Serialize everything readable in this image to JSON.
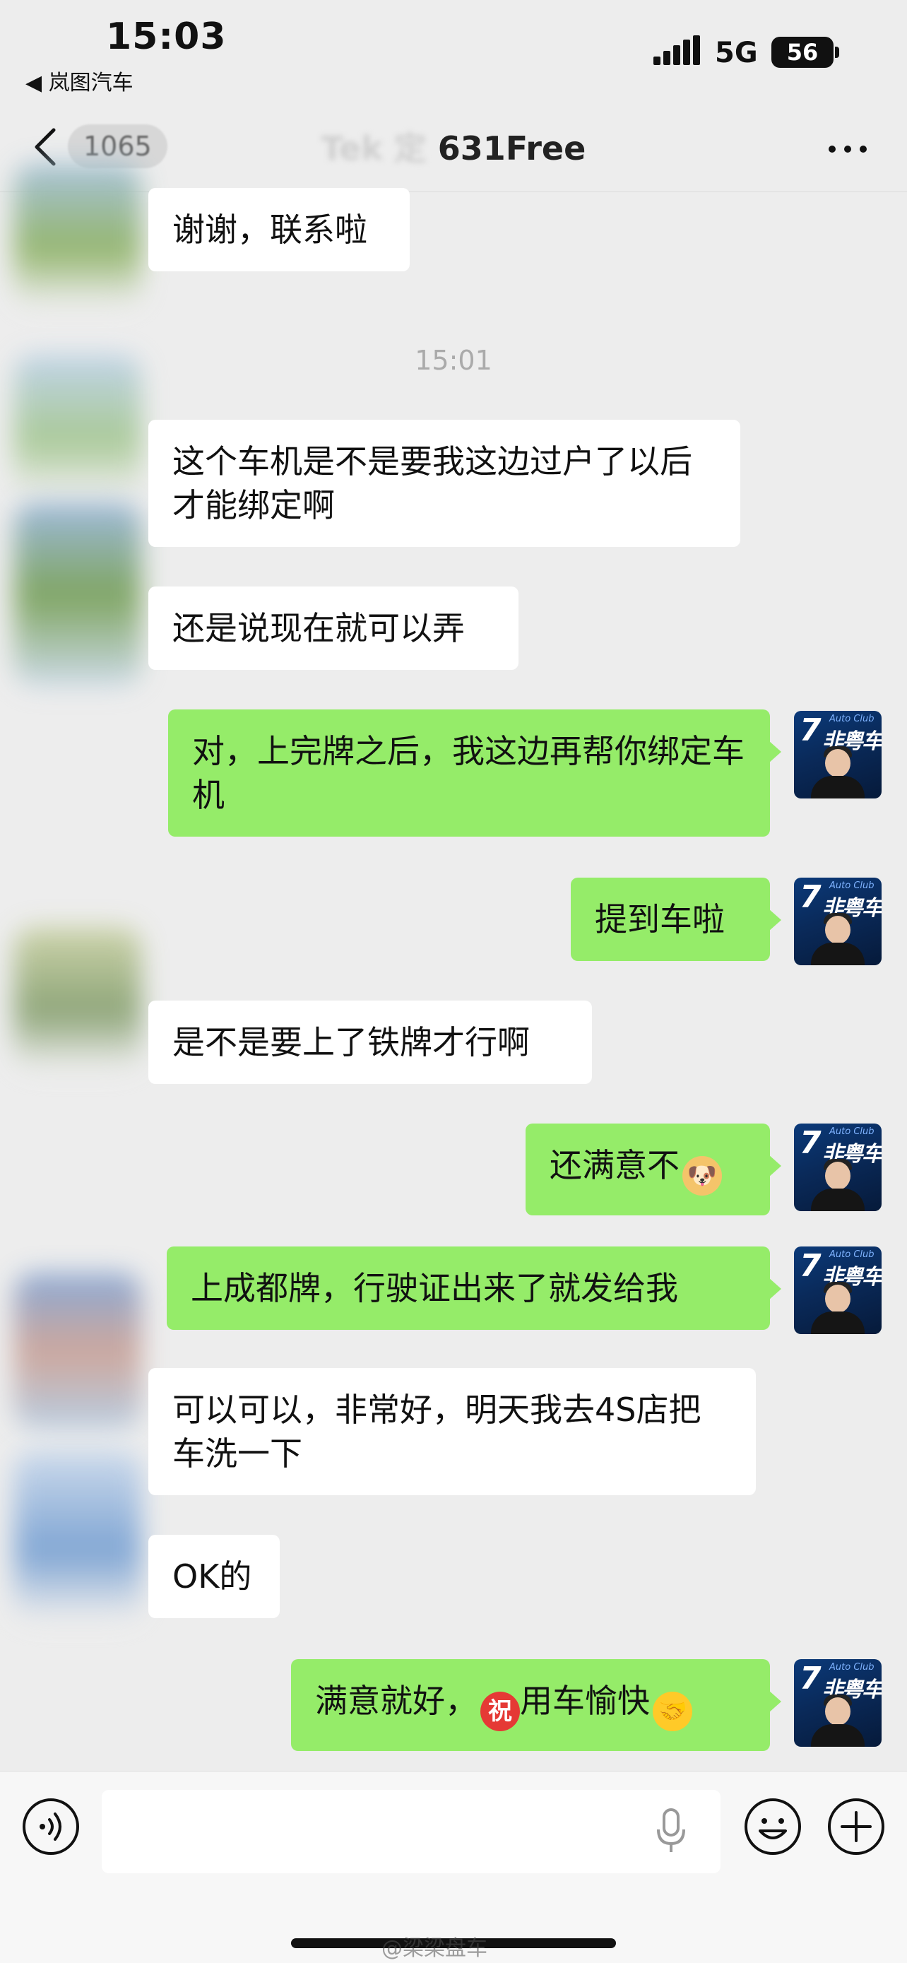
{
  "status_bar": {
    "time": "15:03",
    "back_app": "◀ 岚图汽车",
    "network": "5G",
    "battery": "56"
  },
  "nav": {
    "unread_count": "1065",
    "title_blurred": "Tek",
    "title_mid_blurred": "定",
    "title_visible": "631Free"
  },
  "messages": [
    {
      "side": "in",
      "text": "谢谢，联系啦"
    },
    {
      "type": "time",
      "text": "15:01"
    },
    {
      "side": "in",
      "text": "这个车机是不是要我这边过户了以后才能绑定啊"
    },
    {
      "side": "in",
      "text": "还是说现在就可以弄"
    },
    {
      "side": "out",
      "text": "对，上完牌之后，我这边再帮你绑定车机"
    },
    {
      "side": "out",
      "text": "提到车啦"
    },
    {
      "side": "in",
      "text": "是不是要上了铁牌才行啊"
    },
    {
      "side": "out",
      "text": "还满意不",
      "emoji": "doge-emoji"
    },
    {
      "side": "out",
      "text": "上成都牌，行驶证出来了就发给我"
    },
    {
      "side": "in",
      "text": "可以可以，非常好，明天我去4S店把车洗一下"
    },
    {
      "side": "in",
      "text": "OK的"
    },
    {
      "side": "out",
      "text_before": "满意就好，",
      "emoji_mid": "祝",
      "text_after": "用车愉快",
      "emoji": "handshake-emoji"
    }
  ],
  "avatar": {
    "logo_number": "7",
    "logo_text": "非粤车",
    "logo_sub": "Auto Club"
  },
  "watermark": "@梁梁盘车",
  "colors": {
    "background": "#ededed",
    "bubble_out": "#95ec69",
    "bubble_in": "#ffffff"
  }
}
